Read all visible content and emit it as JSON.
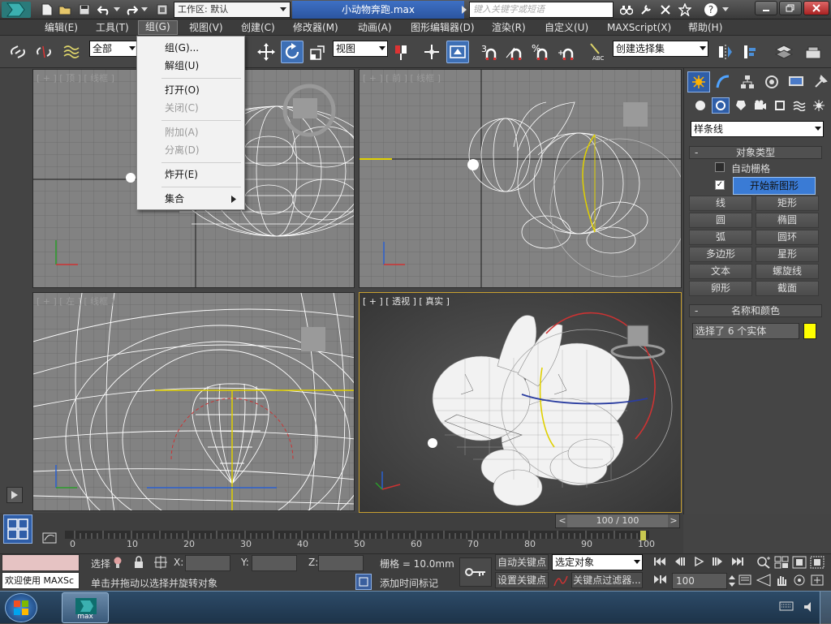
{
  "titlebar": {
    "workspace_label": "工作区: 默认",
    "document_title": "小动物奔跑.max",
    "search_placeholder": "键入关键字或短语"
  },
  "menubar": {
    "items": [
      "编辑(E)",
      "工具(T)",
      "组(G)",
      "视图(V)",
      "创建(C)",
      "修改器(M)",
      "动画(A)",
      "图形编辑器(D)",
      "渲染(R)",
      "自定义(U)",
      "MAXScript(X)",
      "帮助(H)"
    ]
  },
  "toolbar": {
    "selection_filter": "全部",
    "reference_coord": "视图",
    "named_selection": "创建选择集"
  },
  "group_menu": {
    "items": [
      {
        "label": "组(G)...",
        "enabled": true
      },
      {
        "label": "解组(U)",
        "enabled": true
      },
      {
        "label": "打开(O)",
        "enabled": true
      },
      {
        "label": "关闭(C)",
        "enabled": false
      },
      {
        "label": "附加(A)",
        "enabled": false
      },
      {
        "label": "分离(D)",
        "enabled": false
      },
      {
        "label": "炸开(E)",
        "enabled": true
      },
      {
        "label": "集合",
        "enabled": true
      }
    ]
  },
  "viewports": {
    "top": {
      "label": "[ + ] [ 顶 ] [ 线框 ]"
    },
    "front": {
      "label": "[ + ] [ 前 ] [ 线框 ]"
    },
    "left": {
      "label": "[ + ] [ 左 ] [ 线框 ]"
    },
    "perspective": {
      "label": "[ + ] [ 透视 ] [ 真实 ]"
    }
  },
  "command_panel": {
    "category": "样条线",
    "object_type_header": "对象类型",
    "auto_grid_label": "自动栅格",
    "start_new_shape_label": "开始新图形",
    "buttons": [
      "线",
      "矩形",
      "圆",
      "椭圆",
      "弧",
      "圆环",
      "多边形",
      "星形",
      "文本",
      "螺旋线",
      "卵形",
      "截面"
    ],
    "name_color_header": "名称和颜色",
    "name_value": "选择了 6 个实体",
    "object_color": "#ffff00"
  },
  "timeline": {
    "frame_counter": "100 / 100",
    "ticks": [
      "0",
      "10",
      "20",
      "30",
      "40",
      "50",
      "60",
      "70",
      "80",
      "90",
      "100"
    ]
  },
  "status": {
    "welcome": "欢迎使用 MAXSc",
    "selection_label": "选择",
    "x_label": "X:",
    "y_label": "Y:",
    "z_label": "Z:",
    "grid_label": "栅格 = 10.0mm",
    "auto_key_label": "自动关键点",
    "set_key_label": "设置关键点",
    "key_mode_value": "选定对象",
    "key_filters_label": "关键点过滤器...",
    "add_time_tag_label": "添加时间标记",
    "prompt": "单击并拖动以选择并旋转对象",
    "current_frame": "100"
  },
  "taskbar": {
    "app_label": "max"
  }
}
